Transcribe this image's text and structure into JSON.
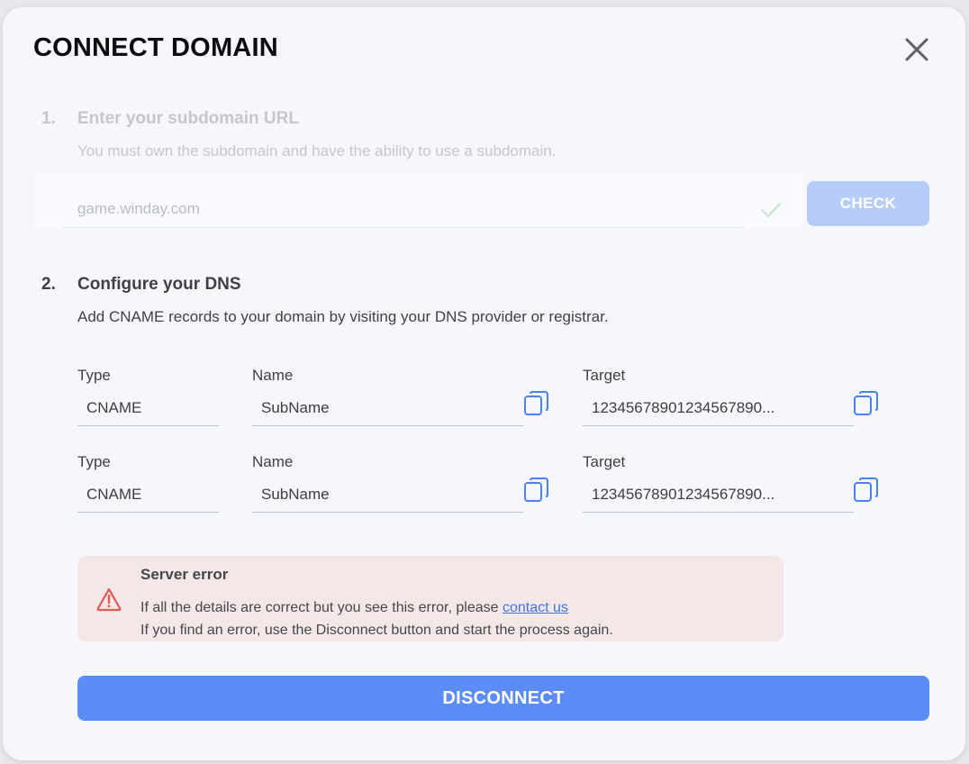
{
  "dialog": {
    "title": "CONNECT DOMAIN"
  },
  "step1": {
    "number": "1.",
    "title": "Enter your subdomain URL",
    "description": "You must own the subdomain and have the ability to use a subdomain.",
    "input_placeholder": "game.winday.com",
    "input_value": "",
    "check_label": "CHECK"
  },
  "step2": {
    "number": "2.",
    "title": "Configure your DNS",
    "description": "Add CNAME records to your domain by visiting your DNS provider or registrar.",
    "labels": {
      "type": "Type",
      "name": "Name",
      "target": "Target"
    },
    "records": [
      {
        "type": "CNAME",
        "name": "SubName",
        "target": "12345678901234567890..."
      },
      {
        "type": "CNAME",
        "name": "SubName",
        "target": "12345678901234567890..."
      }
    ]
  },
  "error": {
    "title": "Server error",
    "line1_prefix": "If all the details are correct but you see this error, please ",
    "link_text": "contact us",
    "line2": "If you find an error, use the Disconnect button and start the process again."
  },
  "actions": {
    "disconnect_label": "DISCONNECT"
  },
  "colors": {
    "accent": "#5b8cf7",
    "accent_disabled": "#b6cdf9",
    "error_bg": "#f4e7e7",
    "error_icon": "#e05a4f",
    "check_icon": "#cde9d6"
  },
  "icons": [
    "close-icon",
    "checkmark-icon",
    "copy-icon",
    "warning-icon"
  ]
}
